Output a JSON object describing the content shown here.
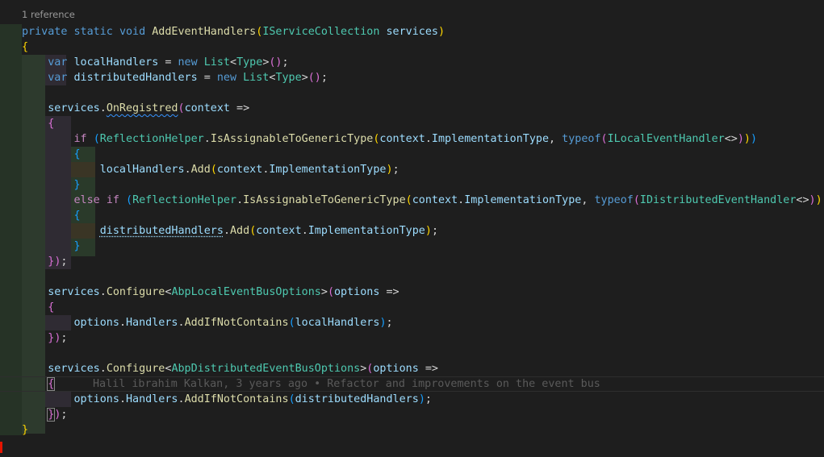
{
  "codelens": "1 reference",
  "blame": "Halil ibrahim Kalkan, 3 years ago • Refactor and improvements on the event bus",
  "tokens": {
    "private": "private",
    "static": "static",
    "void": "void",
    "method": "AddEventHandlers",
    "param_type": "IServiceCollection",
    "param_name": "services",
    "var": "var",
    "localHandlers": "localHandlers",
    "distributedHandlers": "distributedHandlers",
    "new": "new",
    "List": "List",
    "Type": "Type",
    "services": "services",
    "OnRegistred": "OnRegistred",
    "context": "context",
    "if": "if",
    "else": "else",
    "ReflectionHelper": "ReflectionHelper",
    "IsAssignable": "IsAssignableToGenericType",
    "ImplementationType": "ImplementationType",
    "typeof": "typeof",
    "ILocalEventHandler": "ILocalEventHandler",
    "IDistributedEventHandler": "IDistributedEventHandler",
    "Add": "Add",
    "Configure": "Configure",
    "AbpLocalEventBusOptions": "AbpLocalEventBusOptions",
    "AbpDistributedEventBusOptions": "AbpDistributedEventBusOptions",
    "options": "options",
    "Handlers": "Handlers",
    "AddIfNotContains": "AddIfNotContains"
  }
}
